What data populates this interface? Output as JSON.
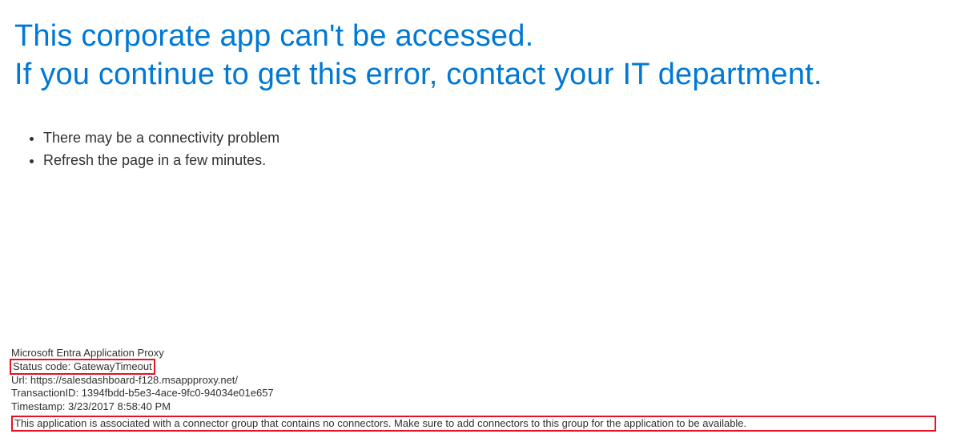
{
  "heading": {
    "line1": "This corporate app can't be accessed.",
    "line2": "If you continue to get this error, contact your IT department."
  },
  "suggestions": {
    "items": [
      "There may be a connectivity problem",
      "Refresh the page in a few minutes."
    ]
  },
  "footer": {
    "product": "Microsoft Entra Application Proxy",
    "status_label": "Status code:",
    "status_value": "GatewayTimeout",
    "url_label": "Url:",
    "url_value": "https://salesdashboard-f128.msappproxy.net/",
    "txn_label": "TransactionID:",
    "txn_value": "1394fbdd-b5e3-4ace-9fc0-94034e01e657",
    "ts_label": "Timestamp:",
    "ts_value": "3/23/2017 8:58:40 PM",
    "message": "This application is associated with a connector group that contains no connectors. Make sure to add connectors to this group for the application to be available."
  }
}
